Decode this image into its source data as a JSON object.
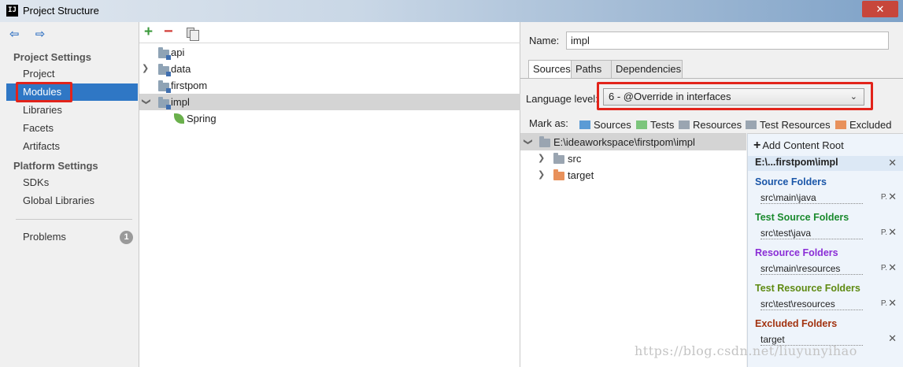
{
  "window": {
    "title": "Project Structure",
    "app_icon_text": "IJ",
    "close_label": "✕"
  },
  "left_nav": {
    "back_forward": "⇦ ⇨",
    "project_settings_header": "Project Settings",
    "project_items": [
      "Project",
      "Modules",
      "Libraries",
      "Facets",
      "Artifacts"
    ],
    "platform_settings_header": "Platform Settings",
    "platform_items": [
      "SDKs",
      "Global Libraries"
    ],
    "problems_label": "Problems",
    "problems_count": "1",
    "selected_item": "Modules"
  },
  "module_toolbar": {
    "add_icon": "+",
    "remove_icon": "−"
  },
  "module_tree": {
    "items": [
      {
        "label": "api",
        "expandable": false
      },
      {
        "label": "data",
        "expandable": true
      },
      {
        "label": "firstpom",
        "expandable": false
      },
      {
        "label": "impl",
        "expandable": true,
        "expanded": true,
        "selected": true
      },
      {
        "label": "Spring",
        "child": true
      }
    ]
  },
  "module_details": {
    "name_label": "Name:",
    "name_value": "impl",
    "tabs": [
      "Sources",
      "Paths",
      "Dependencies"
    ],
    "active_tab": "Sources",
    "language_level_label": "Language level:",
    "language_level_value": "6 - @Override in interfaces",
    "mark_as_label": "Mark as:",
    "mark_as_options": [
      {
        "label": "Sources",
        "color": "#5b9bd5"
      },
      {
        "label": "Tests",
        "color": "#7cc57c"
      },
      {
        "label": "Resources",
        "color": "#9aa5b1"
      },
      {
        "label": "Test Resources",
        "color": "#9aa5b1"
      },
      {
        "label": "Excluded",
        "color": "#e8915b"
      }
    ],
    "content_tree": {
      "root": "E:\\ideaworkspace\\firstpom\\impl",
      "children": [
        {
          "label": "src",
          "color": "#9aa5b1"
        },
        {
          "label": "target",
          "color": "#e8915b"
        }
      ]
    }
  },
  "content_roots": {
    "add_label": "Add Content Root",
    "root_path": "E:\\...firstpom\\impl",
    "groups": [
      {
        "title": "Source Folders",
        "path": "src\\main\\java",
        "color": "#1a56a8"
      },
      {
        "title": "Test Source Folders",
        "path": "src\\test\\java",
        "color": "#1a8a2e"
      },
      {
        "title": "Resource Folders",
        "path": "src\\main\\resources",
        "color": "#8a2dd6"
      },
      {
        "title": "Test Resource Folders",
        "path": "src\\test\\resources",
        "color": "#5e8a12"
      },
      {
        "title": "Excluded Folders",
        "path": "target",
        "color": "#a2320f"
      }
    ],
    "p_label": "P.",
    "remove_label": "✕"
  },
  "watermark": "https://blog.csdn.net/liuyunyihao",
  "colors": {
    "selection": "#2f77c5",
    "highlight_box": "#e2231a"
  }
}
